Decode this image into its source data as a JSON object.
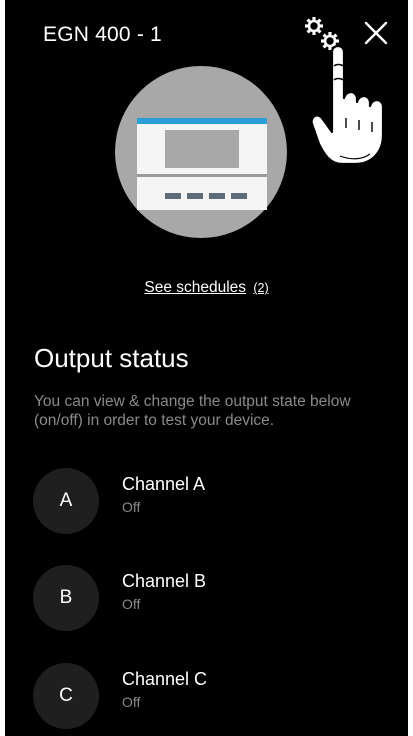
{
  "header": {
    "device_title": "EGN 400 - 1",
    "settings_icon": "gears-icon",
    "close_icon": "close-icon"
  },
  "device": {
    "image_icon": "device-illustration"
  },
  "schedules": {
    "link_text": "See schedules",
    "count": "(2)"
  },
  "output": {
    "title": "Output status",
    "description": "You can view & change the output state below (on/off) in order to test your device."
  },
  "channels": [
    {
      "letter": "A",
      "name": "Channel A",
      "state": "Off"
    },
    {
      "letter": "B",
      "name": "Channel B",
      "state": "Off"
    },
    {
      "letter": "C",
      "name": "Channel C",
      "state": "Off"
    }
  ],
  "colors": {
    "background": "#000000",
    "text_primary": "#ffffff",
    "text_secondary": "#8a8a8a",
    "avatar_bg": "#1f1f1f",
    "device_circle": "#a8a8a8",
    "device_accent": "#2a9fd6"
  }
}
